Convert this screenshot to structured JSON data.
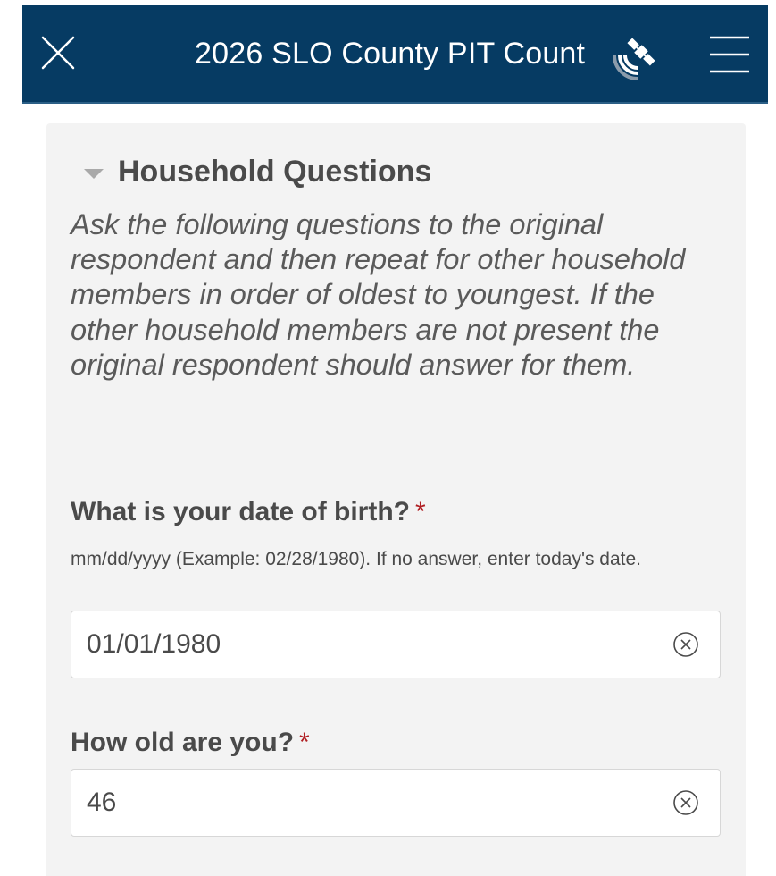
{
  "header": {
    "title": "2026 SLO County PIT Count",
    "close_icon": "close-icon",
    "gps_icon": "satellite-gps-icon",
    "menu_icon": "hamburger-menu-icon",
    "background_color": "#063b63"
  },
  "group": {
    "title": "Household Questions",
    "expanded": true,
    "description": "Ask the following questions to the original respondent and then repeat for other household members in order of oldest to youngest. If the other household members are not present the original respondent should answer for them."
  },
  "questions": [
    {
      "label": "What is your date of birth?",
      "required_marker": "*",
      "hint": "mm/dd/yyyy (Example: 02/28/1980). If no answer, enter today's date.",
      "value": "01/01/1980",
      "clear_icon": "clear-circle-icon"
    },
    {
      "label": "How old are you?",
      "required_marker": "*",
      "value": "46",
      "clear_icon": "clear-circle-icon"
    }
  ],
  "colors": {
    "required": "#b01e22",
    "panel": "#f3f3f3",
    "text": "#4a4a4a"
  }
}
